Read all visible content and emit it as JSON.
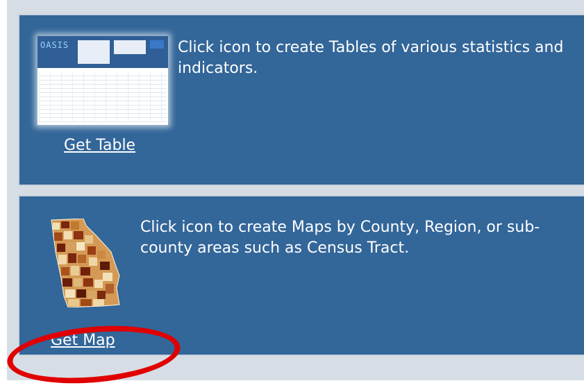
{
  "table_section": {
    "description": "Click icon to create Tables of various statistics and indicators.",
    "link_label": "Get Table",
    "thumbnail_logo": "OASIS"
  },
  "map_section": {
    "description": "Click icon to create Maps by County, Region, or sub-county areas such as Census Tract.",
    "link_label": "Get Map"
  },
  "colors": {
    "panel_bg": "#336699",
    "highlight_oval": "#e00000"
  }
}
